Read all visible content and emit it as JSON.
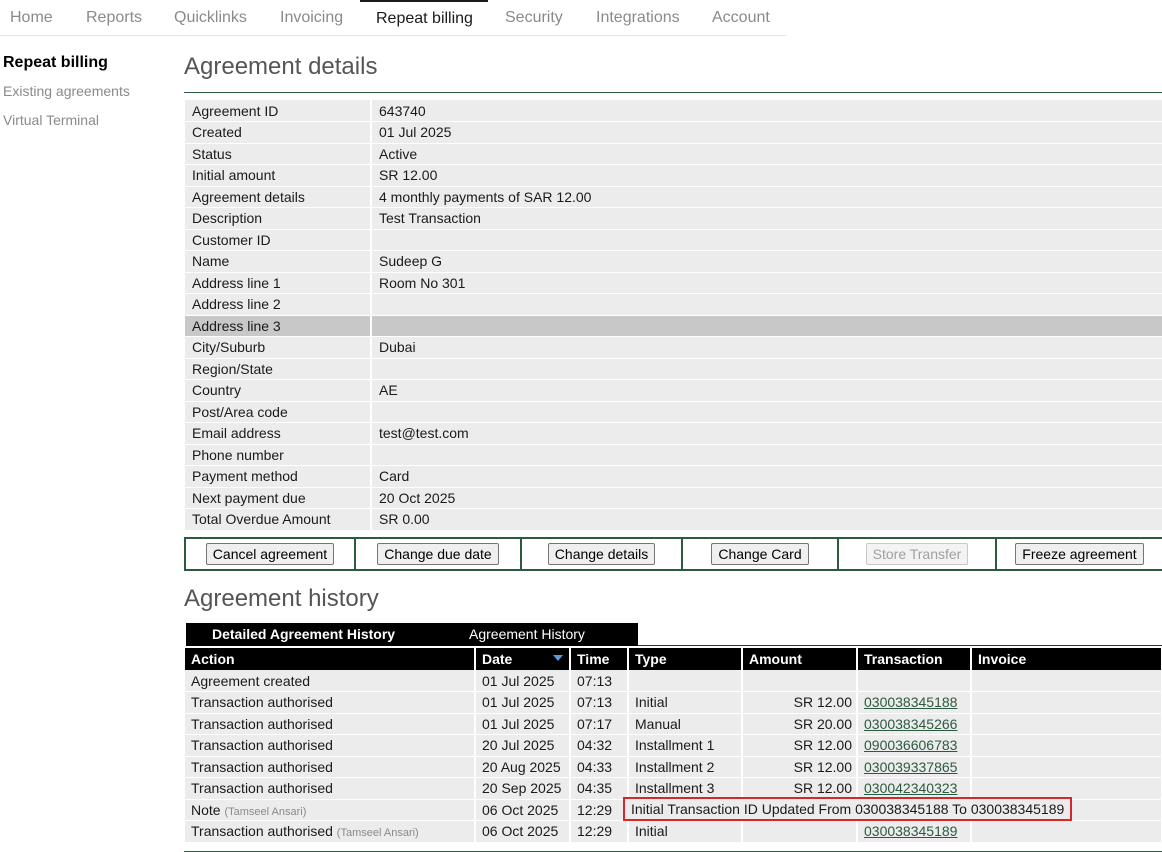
{
  "nav": {
    "tabs": [
      {
        "label": "Home"
      },
      {
        "label": "Reports"
      },
      {
        "label": "Quicklinks"
      },
      {
        "label": "Invoicing"
      },
      {
        "label": "Repeat billing",
        "active": true
      },
      {
        "label": "Security"
      },
      {
        "label": "Integrations"
      },
      {
        "label": "Account"
      }
    ]
  },
  "sidebar": {
    "title": "Repeat billing",
    "links": [
      {
        "label": "Existing agreements"
      },
      {
        "label": "Virtual Terminal"
      }
    ]
  },
  "details": {
    "title": "Agreement details",
    "rows": [
      {
        "label": "Agreement ID",
        "value": "643740"
      },
      {
        "label": "Created",
        "value": "01 Jul 2025"
      },
      {
        "label": "Status",
        "value": "Active"
      },
      {
        "label": "Initial amount",
        "value": "SR 12.00"
      },
      {
        "label": "Agreement details",
        "value": "4 monthly payments of SAR 12.00"
      },
      {
        "label": "Description",
        "value": "Test Transaction"
      },
      {
        "label": "Customer ID",
        "value": ""
      },
      {
        "label": "Name",
        "value": "Sudeep G"
      },
      {
        "label": "Address line 1",
        "value": "Room No 301"
      },
      {
        "label": "Address line 2",
        "value": ""
      },
      {
        "label": "Address line 3",
        "value": "",
        "highlighted": true
      },
      {
        "label": "City/Suburb",
        "value": "Dubai"
      },
      {
        "label": "Region/State",
        "value": ""
      },
      {
        "label": "Country",
        "value": "AE"
      },
      {
        "label": "Post/Area code",
        "value": ""
      },
      {
        "label": "Email address",
        "value": "test@test.com"
      },
      {
        "label": "Phone number",
        "value": ""
      },
      {
        "label": "Payment method",
        "value": "Card"
      },
      {
        "label": "Next payment due",
        "value": "20 Oct 2025"
      },
      {
        "label": "Total Overdue Amount",
        "value": "SR 0.00"
      }
    ]
  },
  "actions": [
    {
      "label": "Cancel agreement",
      "disabled": false
    },
    {
      "label": "Change due date",
      "disabled": false
    },
    {
      "label": "Change details",
      "disabled": false
    },
    {
      "label": "Change Card",
      "disabled": false
    },
    {
      "label": "Store Transfer",
      "disabled": true
    },
    {
      "label": "Freeze agreement",
      "disabled": false
    }
  ],
  "history": {
    "title": "Agreement history",
    "subtabs": [
      {
        "label": "Detailed Agreement History",
        "active": true
      },
      {
        "label": "Agreement History"
      }
    ],
    "columns": [
      "Action",
      "Date",
      "Time",
      "Type",
      "Amount",
      "Transaction",
      "Invoice"
    ],
    "rows": [
      {
        "action": "Agreement created",
        "by": "",
        "date": "01 Jul 2025",
        "time": "07:13",
        "type": "",
        "amount": "",
        "transaction": "",
        "invoice": ""
      },
      {
        "action": "Transaction authorised",
        "by": "",
        "date": "01 Jul 2025",
        "time": "07:13",
        "type": "Initial",
        "amount": "SR 12.00",
        "transaction": "030038345188",
        "invoice": ""
      },
      {
        "action": "Transaction authorised",
        "by": "",
        "date": "01 Jul 2025",
        "time": "07:17",
        "type": "Manual",
        "amount": "SR 20.00",
        "transaction": "030038345266",
        "invoice": ""
      },
      {
        "action": "Transaction authorised",
        "by": "",
        "date": "20 Jul 2025",
        "time": "04:32",
        "type": "Installment 1",
        "amount": "SR 12.00",
        "transaction": "090036606783",
        "invoice": ""
      },
      {
        "action": "Transaction authorised",
        "by": "",
        "date": "20 Aug 2025",
        "time": "04:33",
        "type": "Installment 2",
        "amount": "SR 12.00",
        "transaction": "030039337865",
        "invoice": ""
      },
      {
        "action": "Transaction authorised",
        "by": "",
        "date": "20 Sep 2025",
        "time": "04:35",
        "type": "Installment 3",
        "amount": "SR 12.00",
        "transaction": "030042340323",
        "invoice": ""
      },
      {
        "action": "Note",
        "by": "(Tamseel Ansari)",
        "date": "06 Oct 2025",
        "time": "12:29",
        "note": "Initial Transaction ID Updated From 030038345188 To 030038345189"
      },
      {
        "action": "Transaction authorised",
        "by": "(Tamseel Ansari)",
        "date": "06 Oct 2025",
        "time": "12:29",
        "type": "Initial",
        "amount": "",
        "transaction": "030038345189",
        "invoice": ""
      }
    ]
  },
  "colors": {
    "accent": "#2c5a3e",
    "note_highlight": "#d62828",
    "sort_indicator": "#5b9bd5"
  }
}
